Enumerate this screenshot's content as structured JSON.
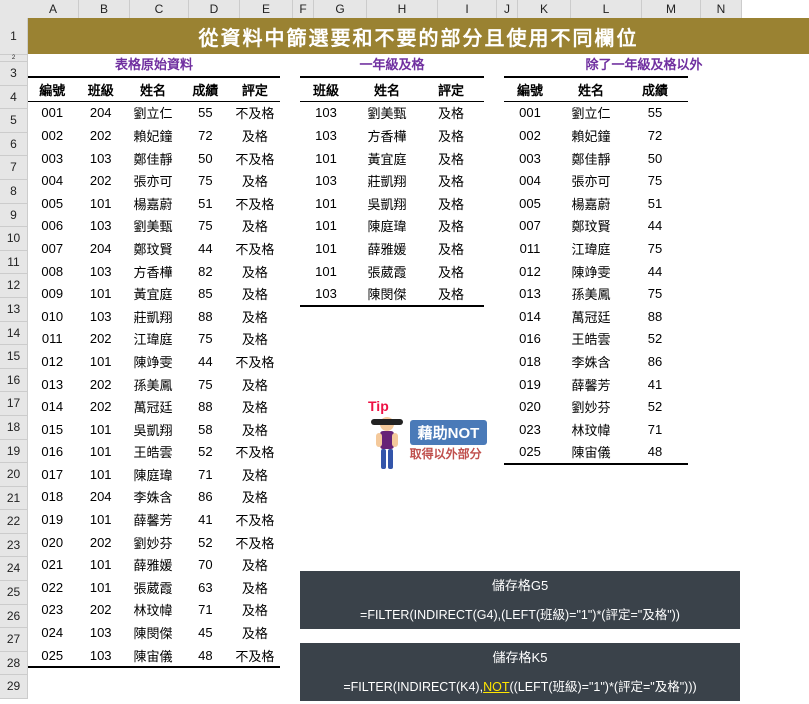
{
  "cols": [
    "A",
    "B",
    "C",
    "D",
    "E",
    "F",
    "G",
    "H",
    "I",
    "J",
    "K",
    "L",
    "M",
    "N"
  ],
  "rowstart": 1,
  "rowend": 29,
  "title": "從資料中篩選要和不要的部分且使用不同欄位",
  "sect1": "表格原始資料",
  "sect2": "一年級及格",
  "sect3": "除了一年級及格以外",
  "h1": [
    "編號",
    "班級",
    "姓名",
    "成績",
    "評定"
  ],
  "h2": [
    "班級",
    "姓名",
    "評定"
  ],
  "h3": [
    "編號",
    "姓名",
    "成績"
  ],
  "t1": [
    [
      "001",
      "204",
      "劉立仁",
      "55",
      "不及格"
    ],
    [
      "002",
      "202",
      "賴妃鐘",
      "72",
      "及格"
    ],
    [
      "003",
      "103",
      "鄭佳靜",
      "50",
      "不及格"
    ],
    [
      "004",
      "202",
      "張亦可",
      "75",
      "及格"
    ],
    [
      "005",
      "101",
      "楊嘉蔚",
      "51",
      "不及格"
    ],
    [
      "006",
      "103",
      "劉美甄",
      "75",
      "及格"
    ],
    [
      "007",
      "204",
      "鄭玟賢",
      "44",
      "不及格"
    ],
    [
      "008",
      "103",
      "方香樺",
      "82",
      "及格"
    ],
    [
      "009",
      "101",
      "黃宜庭",
      "85",
      "及格"
    ],
    [
      "010",
      "103",
      "莊凱翔",
      "88",
      "及格"
    ],
    [
      "011",
      "202",
      "江瑋庭",
      "75",
      "及格"
    ],
    [
      "012",
      "101",
      "陳竫雯",
      "44",
      "不及格"
    ],
    [
      "013",
      "202",
      "孫美鳳",
      "75",
      "及格"
    ],
    [
      "014",
      "202",
      "萬冠廷",
      "88",
      "及格"
    ],
    [
      "015",
      "101",
      "吳凱翔",
      "58",
      "及格"
    ],
    [
      "016",
      "101",
      "王皓雲",
      "52",
      "不及格"
    ],
    [
      "017",
      "101",
      "陳庭瑋",
      "71",
      "及格"
    ],
    [
      "018",
      "204",
      "李姝含",
      "86",
      "及格"
    ],
    [
      "019",
      "101",
      "薛馨芳",
      "41",
      "不及格"
    ],
    [
      "020",
      "202",
      "劉妙芬",
      "52",
      "不及格"
    ],
    [
      "021",
      "101",
      "薛雅媛",
      "70",
      "及格"
    ],
    [
      "022",
      "101",
      "張葳霞",
      "63",
      "及格"
    ],
    [
      "023",
      "202",
      "林玟幃",
      "71",
      "及格"
    ],
    [
      "024",
      "103",
      "陳閔傑",
      "45",
      "及格"
    ],
    [
      "025",
      "103",
      "陳宙儀",
      "48",
      "不及格"
    ]
  ],
  "t2": [
    [
      "103",
      "劉美甄",
      "及格"
    ],
    [
      "103",
      "方香樺",
      "及格"
    ],
    [
      "101",
      "黃宜庭",
      "及格"
    ],
    [
      "103",
      "莊凱翔",
      "及格"
    ],
    [
      "101",
      "吳凱翔",
      "及格"
    ],
    [
      "101",
      "陳庭瑋",
      "及格"
    ],
    [
      "101",
      "薛雅媛",
      "及格"
    ],
    [
      "101",
      "張葳霞",
      "及格"
    ],
    [
      "103",
      "陳閔傑",
      "及格"
    ]
  ],
  "t3": [
    [
      "001",
      "劉立仁",
      "55"
    ],
    [
      "002",
      "賴妃鐘",
      "72"
    ],
    [
      "003",
      "鄭佳靜",
      "50"
    ],
    [
      "004",
      "張亦可",
      "75"
    ],
    [
      "005",
      "楊嘉蔚",
      "51"
    ],
    [
      "007",
      "鄭玟賢",
      "44"
    ],
    [
      "011",
      "江瑋庭",
      "75"
    ],
    [
      "012",
      "陳竫雯",
      "44"
    ],
    [
      "013",
      "孫美鳳",
      "75"
    ],
    [
      "014",
      "萬冠廷",
      "88"
    ],
    [
      "016",
      "王皓雲",
      "52"
    ],
    [
      "018",
      "李姝含",
      "86"
    ],
    [
      "019",
      "薛馨芳",
      "41"
    ],
    [
      "020",
      "劉妙芬",
      "52"
    ],
    [
      "023",
      "林玟幃",
      "71"
    ],
    [
      "025",
      "陳宙儀",
      "48"
    ]
  ],
  "tip": {
    "label": "Tip",
    "main": "藉助NOT",
    "sub": "取得以外部分"
  },
  "f1": {
    "title": "儲存格G5",
    "body": "=FILTER(INDIRECT(G4),(LEFT(班級)=\"1\")*(評定=\"及格\"))"
  },
  "f2": {
    "title": "儲存格K5",
    "pre": "=FILTER(INDIRECT(K4),",
    "hl": "NOT",
    "post": "((LEFT(班級)=\"1\")*(評定=\"及格\")))"
  }
}
